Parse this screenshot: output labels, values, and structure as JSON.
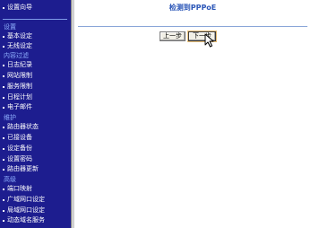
{
  "sidebar": {
    "top_item": "设置向导",
    "sections": [
      {
        "title": "设置",
        "items": [
          "基本设定",
          "无线设定"
        ]
      },
      {
        "title": "内容过滤",
        "items": [
          "日志纪录",
          "网站限制",
          "服务限制",
          "日程计划",
          "电子邮件"
        ]
      },
      {
        "title": "维护",
        "items": [
          "路由器状态",
          "已接设备",
          "设定备份",
          "设置密码",
          "路由器更新"
        ]
      },
      {
        "title": "高级",
        "items": [
          "端口映射",
          "广域网口设定",
          "局域网口设定",
          "动态域名服务"
        ]
      }
    ]
  },
  "main": {
    "title": "检测到PPPoE",
    "prev_label": "上一步",
    "next_label": "下一步"
  },
  "colors": {
    "sidebar_bg": "#1d1d8f",
    "section_title": "#8fb0ff",
    "page_title": "#2c57b8"
  }
}
